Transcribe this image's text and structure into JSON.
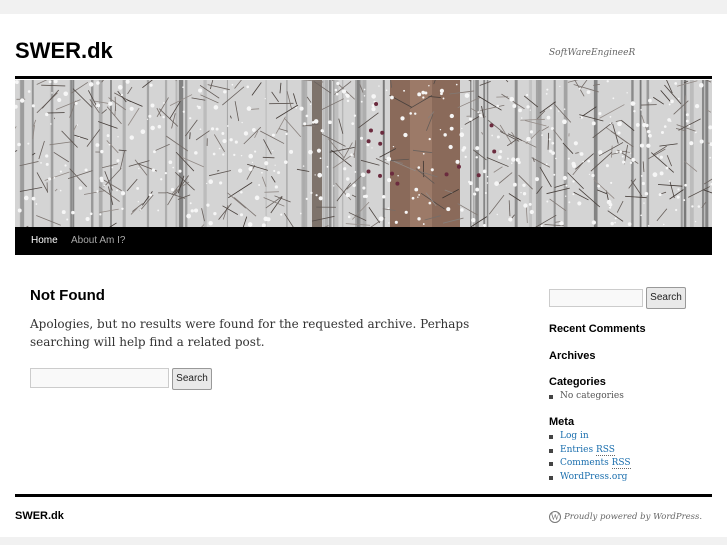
{
  "site": {
    "title": "SWER.dk",
    "tagline": "SoftWareEngineeR"
  },
  "nav": {
    "items": [
      {
        "label": "Home",
        "current": true
      },
      {
        "label": "About Am I?",
        "current": false
      }
    ]
  },
  "main": {
    "heading": "Not Found",
    "message": "Apologies, but no results were found for the requested archive. Perhaps searching will help find a related post.",
    "search": {
      "value": "",
      "button_label": "Search"
    }
  },
  "sidebar": {
    "search": {
      "value": "",
      "button_label": "Search"
    },
    "recent_comments_title": "Recent Comments",
    "archives_title": "Archives",
    "categories": {
      "title": "Categories",
      "items": [
        "No categories"
      ]
    },
    "meta": {
      "title": "Meta",
      "items": [
        {
          "pre": "Log in",
          "abbr": "",
          "post": ""
        },
        {
          "pre": "Entries ",
          "abbr": "RSS",
          "post": ""
        },
        {
          "pre": "Comments ",
          "abbr": "RSS",
          "post": ""
        },
        {
          "pre": "WordPress.org",
          "abbr": "",
          "post": ""
        }
      ]
    }
  },
  "footer": {
    "site_title": "SWER.dk",
    "credit": "Proudly powered by WordPress."
  },
  "colors": {
    "nav_bg": "#000000",
    "link": "#1b6fae",
    "page_bg": "#f1f1f1"
  },
  "icons": {
    "footer_logo": "wordpress-icon"
  }
}
